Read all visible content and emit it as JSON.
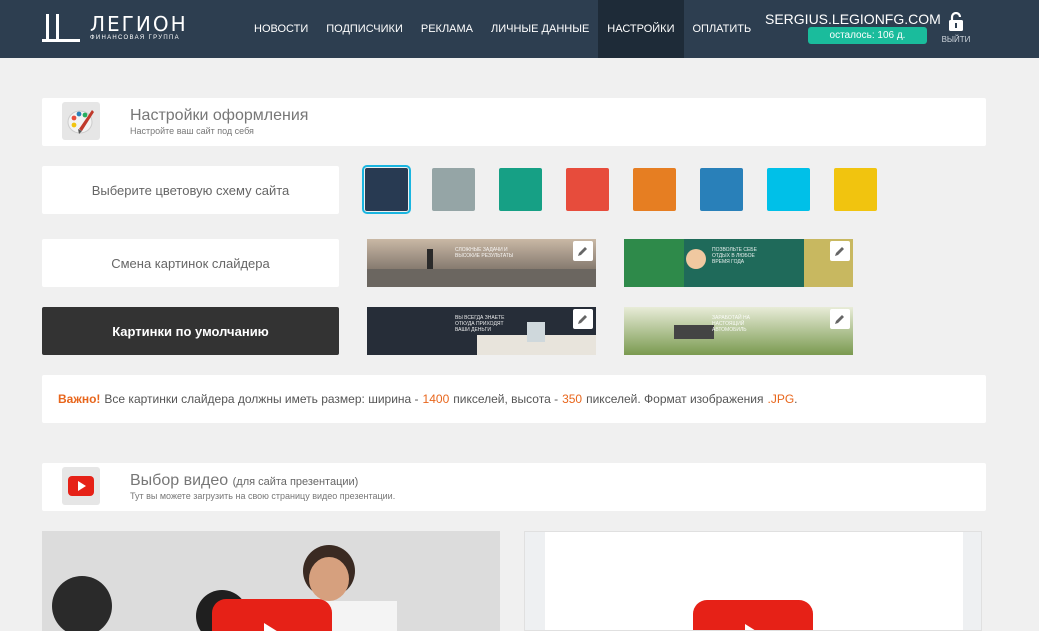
{
  "header": {
    "logo": {
      "title": "ЛЕГИОН",
      "subtitle": "ФИНАНСОВАЯ ГРУППА"
    },
    "nav": [
      "НОВОСТИ",
      "ПОДПИСЧИКИ",
      "РЕКЛАМА",
      "ЛИЧНЫЕ ДАННЫЕ",
      "НАСТРОЙКИ",
      "ОПЛАТИТЬ"
    ],
    "active_nav": "НАСТРОЙКИ",
    "user": "SERGIUS.LEGIONFG.COM",
    "days_left": "осталось: 106 д.",
    "logout": "ВЫЙТИ"
  },
  "design": {
    "title": "Настройки оформления",
    "subtitle": "Настройте ваш сайт под себя",
    "icon": "palette-brush-icon"
  },
  "color_scheme": {
    "label": "Выберите цветовую схему сайта",
    "swatches": [
      "#283a52",
      "#95a5a6",
      "#16a085",
      "#e74c3c",
      "#e67e22",
      "#2980b9",
      "#00c0e8",
      "#f1c40f"
    ],
    "selected_index": 0
  },
  "slider": {
    "label": "Смена картинок слайдера",
    "default_button": "Картинки по умолчанию",
    "images": [
      {
        "caption": "СЛОЖНЫЕ ЗАДАЧИ И ВЫСОКИЕ РЕЗУЛЬТАТЫ",
        "bg": "#8a7c70"
      },
      {
        "caption": "ПОЗВОЛЬТЕ СЕБЕ ОТДЫХ В ЛЮБОЕ ВРЕМЯ ГОДА",
        "bg": "#1f6a5a"
      },
      {
        "caption": "ВЫ ВСЕГДА ЗНАЕТЕ ОТКУДА ПРИХОДЯТ ВАШИ ДЕНЬГИ",
        "bg": "#2a3340"
      },
      {
        "caption": "ЗАРАБОТАЙ НА НАСТОЯЩИЙ АВТОМОБИЛЬ",
        "bg": "#8da86a"
      }
    ]
  },
  "notice": {
    "important": "Важно!",
    "text1": "Все картинки слайдера должны иметь размер: ширина -",
    "width": "1400",
    "text2": "пикселей, высота -",
    "height": "350",
    "text3": "пикселей. Формат изображения",
    "format": ".JPG",
    "end": "."
  },
  "video": {
    "title": "Выбор видео",
    "title_note": "(для сайта презентации)",
    "subtitle": "Тут вы можете загрузить на свою страницу видео презентации.",
    "icon": "youtube-play-icon"
  },
  "colors": {
    "header_bg": "#2d3e50",
    "accent": "#1abc9c",
    "highlight": "#e8661c"
  }
}
